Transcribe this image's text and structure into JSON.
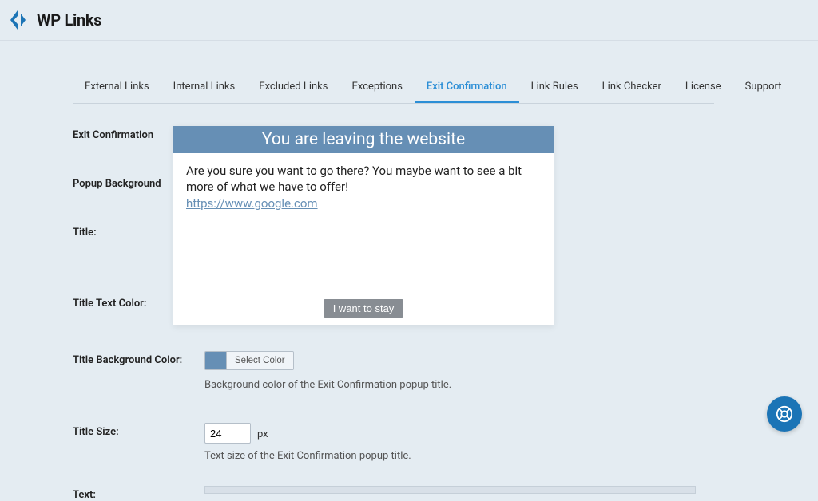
{
  "brand": "WP Links",
  "tabs": [
    {
      "label": "External Links"
    },
    {
      "label": "Internal Links"
    },
    {
      "label": "Excluded Links"
    },
    {
      "label": "Exceptions"
    },
    {
      "label": "Exit Confirmation",
      "active": true
    },
    {
      "label": "Link Rules"
    },
    {
      "label": "Link Checker"
    },
    {
      "label": "License"
    },
    {
      "label": "Support"
    }
  ],
  "fields": {
    "exit_confirmation": {
      "label": "Exit Confirmation"
    },
    "popup_background": {
      "label": "Popup Background"
    },
    "title": {
      "label": "Title:"
    },
    "title_text_color": {
      "label": "Title Text Color:"
    },
    "title_bg_color": {
      "label": "Title Background Color:",
      "select_btn": "Select Color",
      "helper": "Background color of the Exit Confirmation popup title."
    },
    "title_size": {
      "label": "Title Size:",
      "value": "24",
      "unit": "px",
      "helper": "Text size of the Exit Confirmation popup title."
    },
    "text": {
      "label": "Text:"
    }
  },
  "popup": {
    "title": "You are leaving the website",
    "body": "Are you sure you want to go there? You maybe want to see a bit more of what we have to offer!",
    "link": "https://www.google.com",
    "stay_btn": "I want to stay"
  },
  "colors": {
    "title_bg": "#668fb5"
  }
}
